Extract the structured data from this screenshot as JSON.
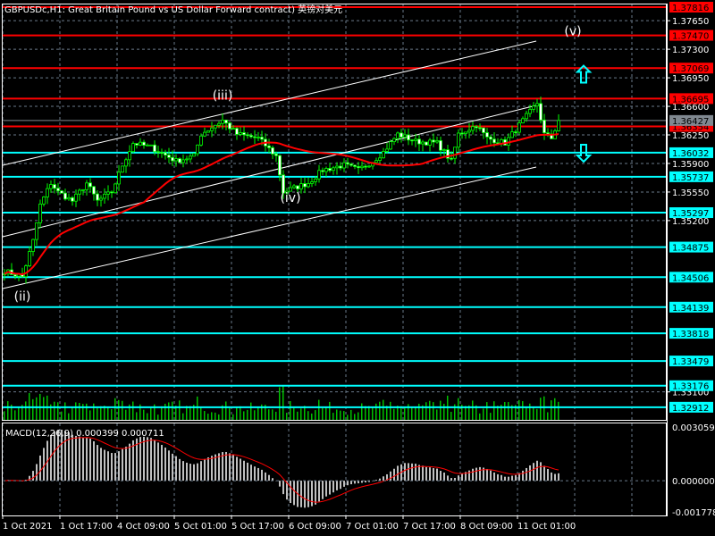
{
  "header": {
    "title": "GBPUSDc,H1:  Great Britain Pound vs US Dollar Forward contract) 英镑对美元"
  },
  "colors": {
    "bull": "#00ff00",
    "bear": "#ffffff",
    "ma": "#ff0000",
    "resistance": "#ff0000",
    "support": "#00ffff",
    "current": "#808890",
    "grid": "#6a7a8a",
    "macd_hist": "#c0c0c0",
    "macd_signal": "#ff0000"
  },
  "chart_data": {
    "type": "candlestick",
    "symbol": "GBPUSDc",
    "timeframe": "H1",
    "ylim": [
      1.3283,
      1.3788
    ],
    "bar_count": 156,
    "close_waypoints": [
      [
        0,
        1.3458
      ],
      [
        5,
        1.3451
      ],
      [
        8,
        1.3495
      ],
      [
        10,
        1.3539
      ],
      [
        13,
        1.3566
      ],
      [
        15,
        1.3555
      ],
      [
        19,
        1.3544
      ],
      [
        23,
        1.3566
      ],
      [
        26,
        1.3544
      ],
      [
        30,
        1.3555
      ],
      [
        33,
        1.3588
      ],
      [
        36,
        1.3615
      ],
      [
        41,
        1.361
      ],
      [
        48,
        1.3593
      ],
      [
        53,
        1.3599
      ],
      [
        55,
        1.3626
      ],
      [
        61,
        1.3643
      ],
      [
        65,
        1.3626
      ],
      [
        71,
        1.3621
      ],
      [
        76,
        1.3599
      ],
      [
        78,
        1.3555
      ],
      [
        81,
        1.356
      ],
      [
        85,
        1.3566
      ],
      [
        89,
        1.3582
      ],
      [
        95,
        1.3588
      ],
      [
        99,
        1.3582
      ],
      [
        103,
        1.3593
      ],
      [
        106,
        1.3604
      ],
      [
        110,
        1.3626
      ],
      [
        115,
        1.3617
      ],
      [
        121,
        1.3615
      ],
      [
        125,
        1.3593
      ],
      [
        127,
        1.3626
      ],
      [
        132,
        1.3637
      ],
      [
        135,
        1.3621
      ],
      [
        140,
        1.3615
      ],
      [
        144,
        1.3637
      ],
      [
        149,
        1.3664
      ],
      [
        151,
        1.3626
      ],
      [
        153,
        1.3621
      ],
      [
        155,
        1.36427
      ]
    ],
    "current_price": "1.36427",
    "resistance_levels": [
      "1.37816",
      "1.37470",
      "1.37069",
      "1.36695",
      "1.36354"
    ],
    "support_levels": [
      "1.36032",
      "1.35737",
      "1.35297",
      "1.34875",
      "1.34506",
      "1.34139",
      "1.33818",
      "1.33479",
      "1.33176",
      "1.32912"
    ],
    "price_ticks": [
      "1.37650",
      "1.37300",
      "1.36950",
      "1.36600",
      "1.36250",
      "1.35900",
      "1.35550",
      "1.35200",
      "1.33100"
    ],
    "time_ticks": [
      "1 Oct 2021",
      "1 Oct 17:00",
      "4 Oct 09:00",
      "5 Oct 01:00",
      "5 Oct 17:00",
      "6 Oct 09:00",
      "7 Oct 01:00",
      "7 Oct 17:00",
      "8 Oct 09:00",
      "11 Oct 01:00"
    ],
    "time_tick_bar_spacing": 16,
    "wave_labels": [
      {
        "text": "(ii)",
        "bar": 5,
        "price": 1.3422
      },
      {
        "text": "(iii)",
        "bar": 61,
        "price": 1.3668
      },
      {
        "text": "(iv)",
        "bar": 80,
        "price": 1.3543
      },
      {
        "text": "(v)",
        "bar": 159,
        "price": 1.3747
      }
    ],
    "signals": [
      {
        "type": "up-arrow",
        "price": 1.37
      },
      {
        "type": "down-arrow",
        "price": 1.3602
      }
    ],
    "ma_period": 40,
    "macd": {
      "label": "MACD(12,26,9) 0.000399 0.000711",
      "fast": 12,
      "slow": 26,
      "signal": 9,
      "ylim": [
        -0.001778,
        0.003059
      ],
      "ticks": [
        "0.003059",
        "0.000000",
        "-0.001778"
      ]
    }
  }
}
